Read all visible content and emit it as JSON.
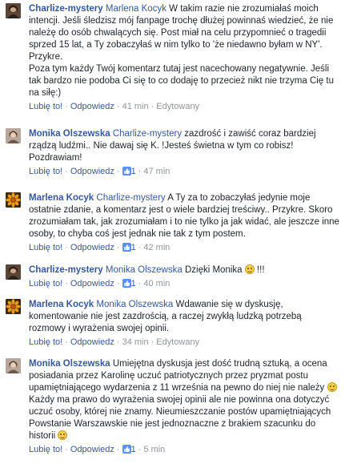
{
  "actions": {
    "like_label": "Lubię to!",
    "reply_label": "Odpowiedz",
    "separator": "·",
    "edited_label": "Edytowany"
  },
  "colors": {
    "author_link": "#365899",
    "meta": "#90949c",
    "text": "#1d2129"
  },
  "comments": [
    {
      "author": "Charlize-mystery",
      "avatar": "portrait-dark",
      "mention": "Marlena Kocyk",
      "line1": " W takim razie nie zrozumiałaś moich",
      "rest": "intencji. Jeśli śledzisz mój fanpage trochę dłużej powinnaś wiedzieć, że nie należę do osób chwalących się. Post miał na celu przypomnieć o tragedii sprzed 15 lat, a Ty zobaczyłaś w nim tylko to 'że niedawno byłam w NY'. Przykre.",
      "text2": "Poza tym każdy Twój komentarz tutaj jest nacechowany negatywnie. Jeśli tak bardzo nie podoba Ci się to co dodaję to przecież nikt nie trzyma Cię tu na siłę:)",
      "time": "41 min",
      "edited": true
    },
    {
      "author": "Monika Olszewska",
      "avatar": "portrait-light",
      "mention": "Charlize-mystery",
      "text": " zazdrość i zawiść coraz bardziej rządzą ludźmi.. Nie dawaj się K. !Jesteś świetna w tym co robisz! Pozdrawiam!",
      "likes": "1",
      "time": "47 min"
    },
    {
      "author": "Marlena Kocyk",
      "avatar": "orange-flower",
      "mention": "Charlize-mystery",
      "text": " A Ty za to zobaczyłaś jedynie moje ostatnie zdanie, a komentarz jest o wiele bardziej treściwy.. Przykre. Skoro zrozumiałam tak, jak zrozumiałam i to nie tylko ja jak widać, ale jeszcze inne osoby, to chyba coś jest jednak nie tak z tym postem.",
      "likes": "1",
      "time": "42 min"
    },
    {
      "author": "Charlize-mystery",
      "avatar": "portrait-dark",
      "mention": "Monika Olszewska",
      "text": " Dzięki Monika ",
      "after_emoji": " !!!",
      "emoji": "smile-emoji",
      "likes": "1",
      "time": "40 min"
    },
    {
      "author": "Marlena Kocyk",
      "avatar": "orange-flower",
      "mention": "Monika Olszewska",
      "text": " Wdawanie się w dyskusję, komentowanie nie jest zazdrością, a raczej zwykłą ludzką potrzebą rozmowy i wyrażenia swojej opinii.",
      "time": "34 min",
      "edited": true
    },
    {
      "author": "Monika Olszewska",
      "avatar": "portrait-light",
      "text_a": " Umiejętna dyskusja jest dość trudną sztuką, a ocena posiadania przez Karolinę uczuć patriotycznych przez pryzmat postu upamiętniającego wydarzenia z 11 września na pewno do niej nie należy ",
      "emoji": "smile-emoji",
      "text_b": " Każdy ma prawo do wyrażenia swojej opinii ale nie powinna ona dotyczyć uczuć osoby, której nie znamy. Nieumieszczanie postów upamiętniających Powstanie Warszawskie nie jest jednoznaczne z brakiem szacunku do historii ",
      "likes": "1",
      "time": "5 min"
    }
  ]
}
